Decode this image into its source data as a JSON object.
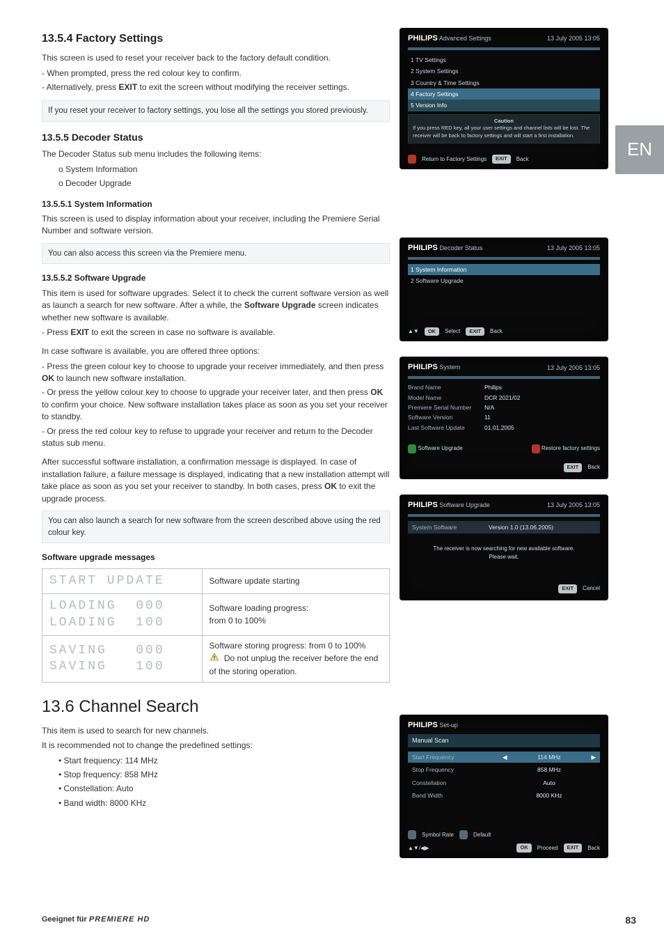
{
  "lang_tab": "EN",
  "footer": {
    "left_text": "Geeignet für",
    "brand": "PREMIERE HD",
    "page_num": "83"
  },
  "s1354": {
    "heading": "13.5.4 Factory Settings",
    "intro": "This screen is used to reset your receiver back to the factory default condition.",
    "b1": "- When prompted, press the red colour key to confirm.",
    "b2_a": "- Alternatively, press ",
    "b2_bold": "EXIT",
    "b2_b": " to exit the screen without modifying the receiver settings.",
    "note": "If you reset your receiver to factory settings, you lose all the settings you stored previously."
  },
  "s1355": {
    "heading": "13.5.5 Decoder Status",
    "intro": "The Decoder Status sub menu includes the following items:",
    "item1": "o System Information",
    "item2": "o Decoder Upgrade"
  },
  "s13551": {
    "heading": "13.5.5.1 System Information",
    "text": "This screen is used to display information about your receiver, including the Premiere Serial Number and software version.",
    "note": "You can also access this screen via the Premiere menu."
  },
  "s13552": {
    "heading": "13.5.5.2 Software Upgrade",
    "p1a": "This item is used for software upgrades. Select it to check the current software version as well as launch a search for new software. After a while, the ",
    "p1bold": "Software Upgrade",
    "p1b": " screen indicates whether new software is available.",
    "b1a": "- Press ",
    "b1bold": "EXIT",
    "b1b": " to exit the screen in case no software is available.",
    "intro2": "In case software is available, you are offered three options:",
    "o1a": "- Press the green colour key to choose to upgrade your receiver immediately, and then press ",
    "o1bold": "OK",
    "o1b": " to launch new software installation.",
    "o2a": "- Or press the yellow colour key to choose to upgrade your receiver later, and then press ",
    "o2bold": "OK",
    "o2b": " to confirm your choice. New software installation takes place as soon as you set your receiver to standby.",
    "o3": "- Or press the red colour key to refuse to upgrade your receiver and return to the Decoder status sub menu.",
    "after_a": "After successful software installation, a confirmation message is displayed. In case of installation failure, a failure message is displayed, indicating that a new installation attempt will take place as soon as you set your receiver to standby. In both cases, press ",
    "after_bold": "OK",
    "after_b": " to exit the upgrade process.",
    "note": "You can also launch a search for new software from the screen described above using the red colour key.",
    "msgs_heading": "Software upgrade messages"
  },
  "msg_table": {
    "r1": {
      "seg": "START UPDATE",
      "desc": "Software update starting"
    },
    "r2": {
      "seg1": "LOADING  000",
      "seg2": "LOADING  100",
      "desc": "Software loading progress:\nfrom 0 to 100%"
    },
    "r3": {
      "seg1": "SAVING   000",
      "seg2": "SAVING   100",
      "desc1": "Software storing progress: from 0 to 100%",
      "desc2": "Do not unplug the receiver before the end of the storing operation."
    }
  },
  "s136": {
    "heading": "13.6 Channel Search",
    "intro1": "This item is used to search for new channels.",
    "intro2": "It is recommended not to change the predefined settings:",
    "b1": "• Start frequency: 114 MHz",
    "b2": "• Stop frequency: 858 MHz",
    "b3": "• Constellation: Auto",
    "b4": "• Band width: 8000 KHz"
  },
  "tv1": {
    "brand": "PHILIPS",
    "screen": "Advanced Settings",
    "datetime": "13 July 2005    13:05",
    "items": [
      "1  TV Settings",
      "2  System Settings",
      "3  Country & Time Settings",
      "4  Factory Settings",
      "5  Version Info"
    ],
    "caution_title": "Caution",
    "caution": "If you press RED key, all your user settings and channel lists will be lost. The receiver will be back to factory settings and will start a first installation.",
    "foot_red": "Return to Factory Settings",
    "foot_exit": "EXIT",
    "foot_back": "Back"
  },
  "tv2": {
    "brand": "PHILIPS",
    "screen": "Decoder Status",
    "datetime": "13 July 2005    13:05",
    "items": [
      "1  System Information",
      "2  Software Upgrade"
    ],
    "foot_nav": "▲▼",
    "foot_ok": "OK",
    "foot_select": "Select",
    "foot_exit": "EXIT",
    "foot_back": "Back"
  },
  "tv3": {
    "brand": "PHILIPS",
    "screen": "System",
    "datetime": "13 July 2005    13:05",
    "rows": [
      {
        "k": "Brand Name",
        "v": "Philips"
      },
      {
        "k": "Model Name",
        "v": "DCR 2021/02"
      },
      {
        "k": "Premiere Serial Number",
        "v": "N/A"
      },
      {
        "k": "Software Version",
        "v": "11"
      },
      {
        "k": "Last Software Update",
        "v": "01.01.2005"
      }
    ],
    "foot_green": "Software Upgrade",
    "foot_red": "Restore factory settings",
    "foot_exit": "EXIT",
    "foot_back": "Back"
  },
  "tv4": {
    "brand": "PHILIPS",
    "screen": "Software Upgrade",
    "datetime": "13 July 2005    13:05",
    "row_k": "System Software",
    "row_v": "Version 1.0 (13.06.2005)",
    "msg": "The receiver is now searching for new available software.\nPlease wait.",
    "foot_exit": "EXIT",
    "foot_cancel": "Cancel"
  },
  "tv5": {
    "brand": "PHILIPS",
    "screen": "Set-up",
    "title": "Manual Scan",
    "rows": [
      {
        "k": "Start Frequency",
        "v": "114 MHz",
        "sel": true
      },
      {
        "k": "Stop Frequency",
        "v": "858 MHz"
      },
      {
        "k": "Constellation",
        "v": "Auto"
      },
      {
        "k": "Band Width",
        "v": "8000 KHz"
      }
    ],
    "foot_sym": "Symbol Rate",
    "foot_def": "Default",
    "foot_nav": "▲▼/◀▶",
    "foot_ok": "OK",
    "foot_proceed": "Proceed",
    "foot_exit": "EXIT",
    "foot_back": "Back"
  }
}
